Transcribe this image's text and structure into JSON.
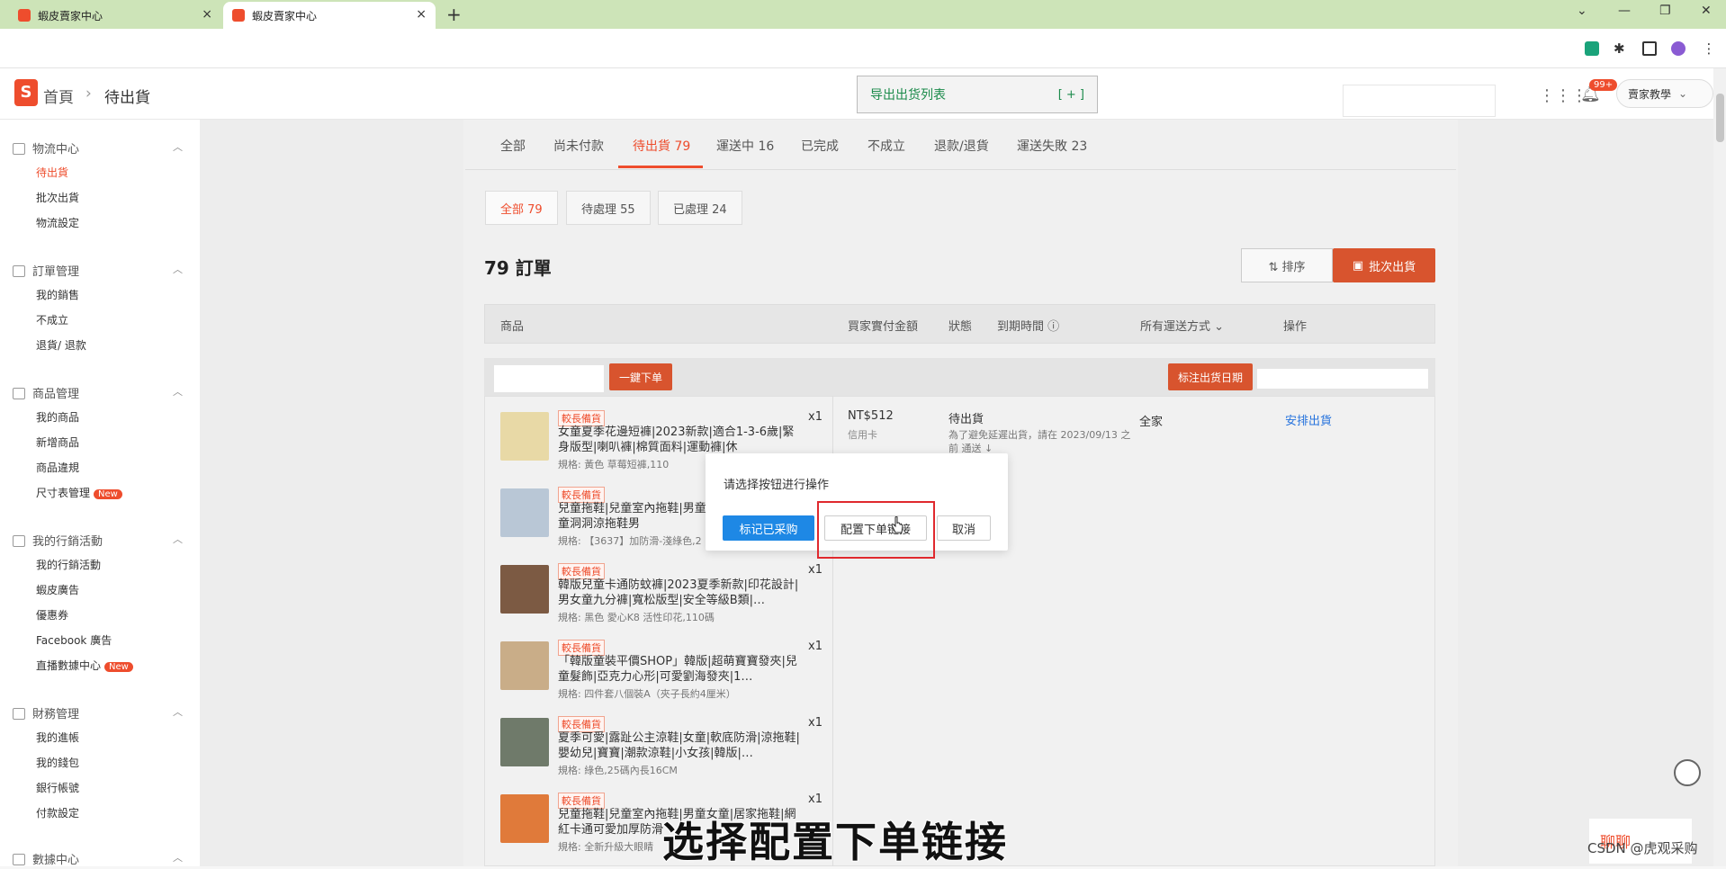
{
  "browser": {
    "tabs": [
      {
        "title": "蝦皮賣家中心",
        "close": "×"
      },
      {
        "title": "蝦皮賣家中心",
        "close": "×"
      }
    ],
    "new_tab": "+",
    "window_controls": [
      "⌄",
      "—",
      "❐",
      "✕"
    ],
    "toolbar_icons": [
      "extension-icon",
      "puzzle-icon",
      "sidepanel-icon",
      "profile-icon",
      "menu-icon"
    ]
  },
  "header": {
    "logo": "S",
    "breadcrumb_home": "首頁",
    "breadcrumb_sep": "›",
    "breadcrumb_current": "待出貨",
    "export_label": "导出出货列表",
    "export_plus": "[ + ]",
    "notification_count": "99+",
    "account_label": "賣家教學"
  },
  "sidebar": {
    "groups": [
      {
        "title": "物流中心",
        "items": [
          "待出貨",
          "批次出貨",
          "物流設定"
        ]
      },
      {
        "title": "訂單管理",
        "items": [
          "我的銷售",
          "不成立",
          "退貨/ 退款"
        ]
      },
      {
        "title": "商品管理",
        "items": [
          "我的商品",
          "新增商品",
          "商品違規",
          "尺寸表管理"
        ]
      },
      {
        "title": "我的行銷活動",
        "items": [
          "我的行銷活動",
          "蝦皮廣告",
          "優惠券",
          "Facebook 廣告",
          "直播數據中心"
        ]
      },
      {
        "title": "財務管理",
        "items": [
          "我的進帳",
          "我的錢包",
          "銀行帳號",
          "付款設定"
        ]
      },
      {
        "title": "數據中心",
        "items": []
      }
    ],
    "new_tag": "New",
    "active_item": "待出貨"
  },
  "main": {
    "tabs": [
      "全部",
      "尚未付款",
      "待出貨 79",
      "運送中 16",
      "已完成",
      "不成立",
      "退款/退貨",
      "運送失敗 23"
    ],
    "subtabs": [
      "全部 79",
      "待處理 55",
      "已處理 24"
    ],
    "order_count_title": "79 訂單",
    "sort_label": "⇅ 排序",
    "batch_label": "批次出貨",
    "columns": [
      "商品",
      "買家實付金額",
      "狀態",
      "到期時間 ⓘ",
      "所有運送方式 ⌄",
      "操作"
    ],
    "one_key_order": "一鍵下单",
    "mark_ship_date": "标注出货日期",
    "items": [
      {
        "tag": "較長備貨",
        "name": "女童夏季花邊短褲|2023新款|適合1-3-6歲|緊身版型|喇叭褲|棉質面料|運動褲|休",
        "spec": "規格: 黃色 草莓短褲,110",
        "qty": "x1"
      },
      {
        "tag": "較長備貨",
        "name": "兒童拖鞋|兒童室內拖鞋|男童女童|可愛寶寶小童洞洞涼拖鞋男",
        "spec": "規格: 【3637】加防滑-淺綠色,2",
        "qty": "x1"
      },
      {
        "tag": "較長備貨",
        "name": "韓版兒童卡通防蚊褲|2023夏季新款|印花設計|男女童九分褲|寬松版型|安全等級B類|…",
        "spec": "規格: 黑色 愛心K8 活性印花,110碼",
        "qty": "x1"
      },
      {
        "tag": "較長備貨",
        "name": "「韓版童裝平價SHOP」韓版|超萌寶寶發夾|兒童髮飾|亞克力心形|可愛劉海發夾|1…",
        "spec": "規格: 四件套八個裝A（夾子長約4厘米）",
        "qty": "x1"
      },
      {
        "tag": "較長備貨",
        "name": "夏季可愛|露趾公主涼鞋|女童|軟底防滑|涼拖鞋|嬰幼兒|寶寶|潮款涼鞋|小女孩|韓版|…",
        "spec": "規格: 綠色,25碼內長16CM",
        "qty": "x1"
      },
      {
        "tag": "較長備貨",
        "name": "兒童拖鞋|兒童室內拖鞋|男童女童|居家拖鞋|網紅卡通可愛加厚防滑",
        "spec": "規格: 全新升級大眼睛",
        "qty": "x1"
      }
    ],
    "price": "NT$512",
    "pay_type": "信用卡",
    "status": "待出貨",
    "status_note": "為了避免延遲出貨，請在 2023/09/13 之前 通送 ↓",
    "carrier": "全家",
    "action": "安排出貨"
  },
  "dialog": {
    "message": "请选择按钮进行操作",
    "btn_mark": "标记已采购",
    "btn_config": "配置下单链接",
    "btn_cancel": "取消"
  },
  "overlay": {
    "subtitle": "选择配置下单链接",
    "chat_label": "聊聊",
    "watermark": "CSDN @虎观采购"
  },
  "colors": {
    "brand": "#ee4d2d",
    "dialog_primary": "#1e88e5",
    "highlight_box": "#e0292e",
    "link": "#2673dd"
  }
}
